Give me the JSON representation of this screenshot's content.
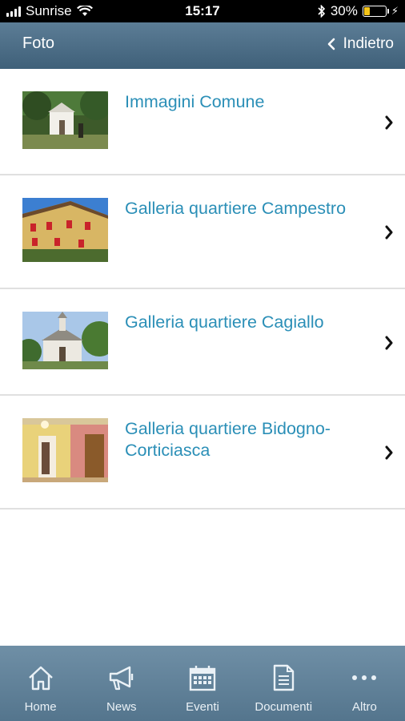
{
  "status_bar": {
    "carrier": "Sunrise",
    "time": "15:17",
    "battery_percent": "30%",
    "battery_level": 0.3
  },
  "nav": {
    "title": "Foto",
    "back_label": "Indietro"
  },
  "gallery": [
    {
      "title": "Immagini Comune",
      "icon": "chevron-right-icon"
    },
    {
      "title": "Galleria quartiere Campestro",
      "icon": "chevron-right-icon"
    },
    {
      "title": "Galleria quartiere Cagiallo",
      "icon": "chevron-right-icon"
    },
    {
      "title": "Galleria quartiere Bidogno-Corticiasca",
      "icon": "chevron-right-icon"
    }
  ],
  "tab_bar": [
    {
      "label": "Home",
      "icon": "home-icon"
    },
    {
      "label": "News",
      "icon": "megaphone-icon"
    },
    {
      "label": "Eventi",
      "icon": "calendar-icon"
    },
    {
      "label": "Documenti",
      "icon": "document-icon"
    },
    {
      "label": "Altro",
      "icon": "more-icon"
    }
  ],
  "colors": {
    "accent": "#2b8fb7",
    "nav_bar": "#4b6c85",
    "tab_bar": "#62839b"
  }
}
